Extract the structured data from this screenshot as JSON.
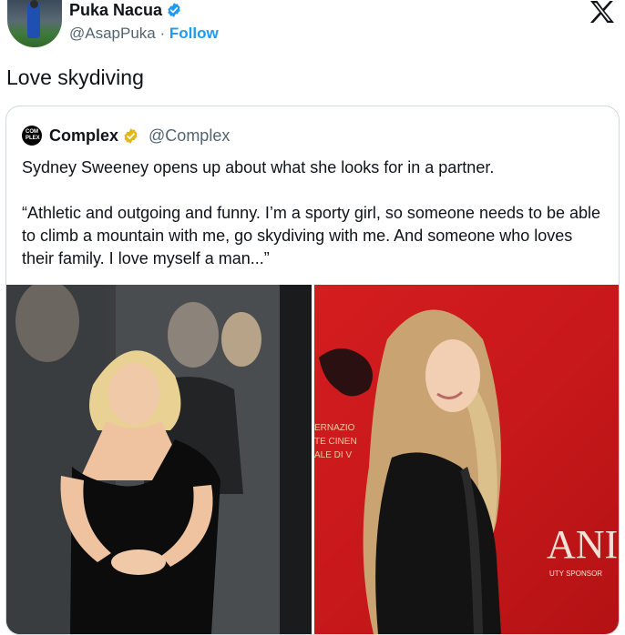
{
  "tweet": {
    "author": {
      "display_name": "Puka Nacua",
      "handle": "@AsapPuka",
      "separator": "·",
      "follow_label": "Follow",
      "verified_icon": "verified-badge-blue-icon"
    },
    "text": "Love skydiving",
    "close_icon": "x-logo-icon"
  },
  "quoted_tweet": {
    "author": {
      "display_name": "Complex",
      "handle": "@Complex",
      "avatar_text": "COM PLEX",
      "verified_icon": "verified-badge-gold-icon"
    },
    "paragraphs": [
      "Sydney Sweeney opens up about what she looks for in a partner.",
      "“Athletic and outgoing and funny. I’m a sporty girl, so someone needs to be able to climb a mountain with me, go skydiving with me. And someone who loves their family. I love myself a man...”"
    ],
    "media": [
      {
        "name": "photo-left-black-dress"
      },
      {
        "name": "photo-right-red-carpet",
        "backdrop_text": [
          "ERNAZIO",
          "TE CINEN",
          "ALE DI V"
        ],
        "logo_text": "ANI",
        "logo_subtext": "UTY SPONSOR"
      }
    ]
  },
  "colors": {
    "accent": "#1d9bf0",
    "secondary_text": "#536471",
    "gold_badge": "#e2b719",
    "red_backdrop": "#c8181b"
  }
}
